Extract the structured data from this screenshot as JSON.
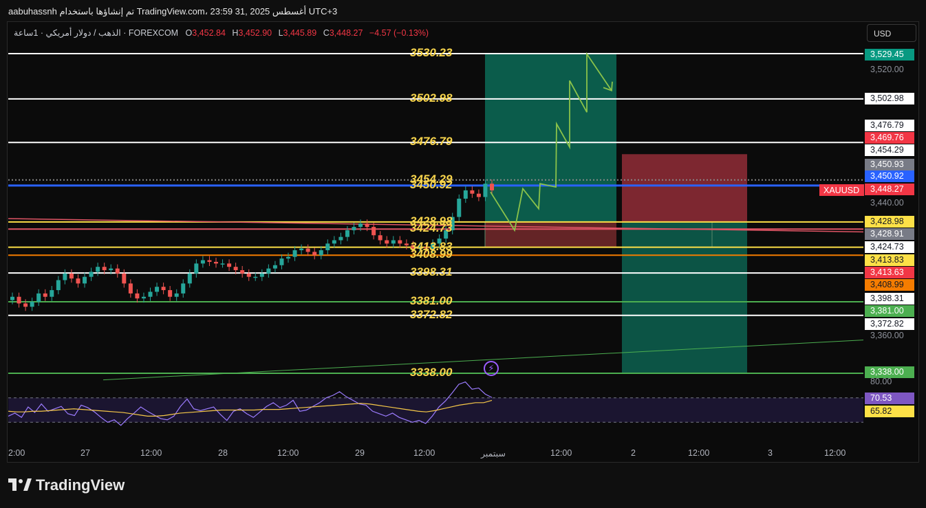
{
  "header": {
    "caption": "aabuhassnh تم إنشاؤها باستخدام TradingView.com، 23:59 31, أغسطس 2025 UTC+3"
  },
  "legend": {
    "title": "الذهب / دولار أمريكي · 1ساعة · FOREXCOM",
    "o_key": "O",
    "o_val": "3,452.84",
    "h_key": "H",
    "h_val": "3,452.90",
    "l_key": "L",
    "l_val": "3,445.89",
    "c_key": "C",
    "c_val": "3,448.27",
    "change": "−4.57 (−0.13%)"
  },
  "currency_button": "USD",
  "symbol_tag": "XAUUSD",
  "levels": [
    "3530.23",
    "3502.98",
    "3476.79",
    "3454.29",
    "3450.92",
    "3428.98",
    "3424.73",
    "3413.83",
    "3408.99",
    "3398.31",
    "3381.00",
    "3372.82",
    "3338.00"
  ],
  "price_tags": [
    {
      "text": "3,529.45",
      "bg": "#089981",
      "fg": "#ffffff"
    },
    {
      "text": "3,502.98",
      "bg": "#ffffff",
      "fg": "#131722"
    },
    {
      "text": "3,476.79",
      "bg": "#ffffff",
      "fg": "#131722"
    },
    {
      "text": "3,469.76",
      "bg": "#f23645",
      "fg": "#ffffff"
    },
    {
      "text": "3,454.29",
      "bg": "#ffffff",
      "fg": "#131722"
    },
    {
      "text": "3,450.93",
      "bg": "#787b86",
      "fg": "#ffffff"
    },
    {
      "text": "3,450.92",
      "bg": "#2962ff",
      "fg": "#ffffff"
    },
    {
      "text": "3,448.27",
      "bg": "#f23645",
      "fg": "#ffffff"
    },
    {
      "text": "3,428.98",
      "bg": "#fde047",
      "fg": "#131722"
    },
    {
      "text": "3,428.91",
      "bg": "#787b86",
      "fg": "#ffffff"
    },
    {
      "text": "3,424.73",
      "bg": "#ffffff",
      "fg": "#131722"
    },
    {
      "text": "3,413.83",
      "bg": "#fde047",
      "fg": "#131722"
    },
    {
      "text": "3,413.63",
      "bg": "#f23645",
      "fg": "#ffffff"
    },
    {
      "text": "3,408.99",
      "bg": "#f57c00",
      "fg": "#131722"
    },
    {
      "text": "3,398.31",
      "bg": "#ffffff",
      "fg": "#131722"
    },
    {
      "text": "3,381.00",
      "bg": "#4caf50",
      "fg": "#ffffff"
    },
    {
      "text": "3,372.82",
      "bg": "#ffffff",
      "fg": "#131722"
    },
    {
      "text": "3,338.00",
      "bg": "#4caf50",
      "fg": "#ffffff"
    },
    {
      "text": "70.53",
      "bg": "#7e57c2",
      "fg": "#ffffff"
    },
    {
      "text": "65.82",
      "bg": "#fde047",
      "fg": "#131722"
    }
  ],
  "price_axis": [
    "3,520.00",
    "3,440.00",
    "3,360.00",
    "80.00"
  ],
  "time_axis": [
    "2:00",
    "27",
    "12:00",
    "28",
    "12:00",
    "29",
    "12:00",
    "سبتمبر",
    "12:00",
    "2",
    "12:00",
    "3",
    "12:00"
  ],
  "brand": "TradingView",
  "chart_data": {
    "type": "candlestick",
    "symbol": "XAUUSD",
    "interval": "1h",
    "ylim": [
      3330,
      3535
    ],
    "horizontal_levels": [
      3530.23,
      3502.98,
      3476.79,
      3454.29,
      3450.92,
      3428.98,
      3424.73,
      3413.83,
      3408.99,
      3398.31,
      3381.0,
      3372.82,
      3338.0
    ],
    "closes": [
      3384,
      3380,
      3378,
      3381,
      3386,
      3384,
      3388,
      3394,
      3398,
      3395,
      3392,
      3396,
      3399,
      3402,
      3400,
      3401,
      3398,
      3392,
      3386,
      3383,
      3384,
      3387,
      3390,
      3388,
      3384,
      3386,
      3392,
      3398,
      3404,
      3406,
      3405,
      3404,
      3404,
      3402,
      3400,
      3398,
      3396,
      3396,
      3398,
      3401,
      3403,
      3407,
      3408,
      3412,
      3413,
      3411,
      3409,
      3412,
      3416,
      3418,
      3420,
      3424,
      3426,
      3428,
      3426,
      3421,
      3418,
      3416,
      3418,
      3416,
      3415,
      3413,
      3414,
      3413,
      3416,
      3419,
      3424,
      3432,
      3443,
      3448,
      3446,
      3444,
      3452,
      3448
    ],
    "rsi": {
      "upper": 70,
      "lower": 30,
      "rsi_last": 70.53,
      "ma_last": 65.82
    }
  }
}
